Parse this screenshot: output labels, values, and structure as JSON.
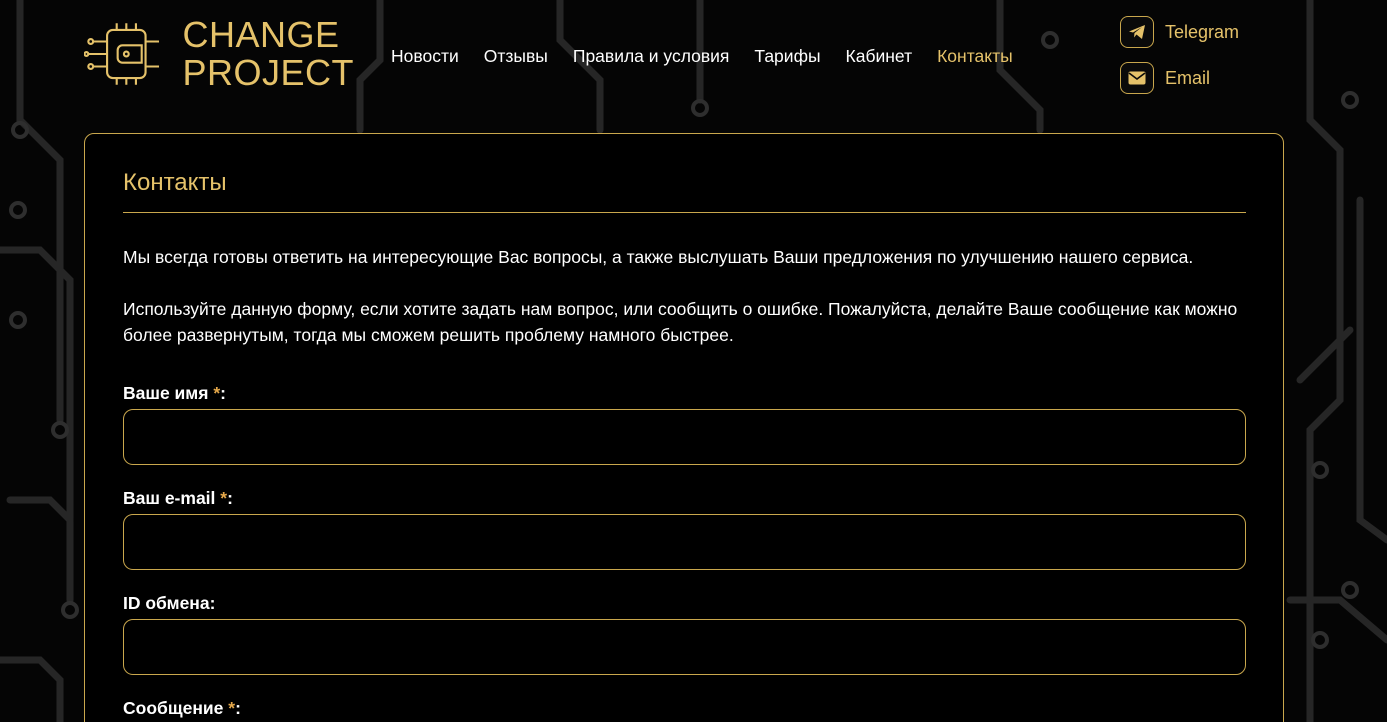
{
  "logo": {
    "line1": "CHANGE",
    "line2": "PROJECT"
  },
  "nav": {
    "items": [
      {
        "label": "Новости"
      },
      {
        "label": "Отзывы"
      },
      {
        "label": "Правила и условия"
      },
      {
        "label": "Тарифы"
      },
      {
        "label": "Кабинет"
      },
      {
        "label": "Контакты",
        "active": true
      }
    ]
  },
  "header_contacts": {
    "telegram": {
      "label": "Telegram",
      "icon": "telegram-icon"
    },
    "email": {
      "label": "Email",
      "icon": "envelope-icon"
    }
  },
  "page": {
    "title": "Контакты",
    "intro1": "Мы всегда готовы ответить на интересующие Вас вопросы, а также выслушать Ваши предложения по улучшению нашего сервиса.",
    "intro2": "Используйте данную форму, если хотите задать нам вопрос, или сообщить о ошибке. Пожалуйста, делайте Ваше сообщение как можно более развернутым, тогда мы сможем решить проблему намного быстрее."
  },
  "form": {
    "name_label": "Ваше имя ",
    "email_label": "Ваш e-mail ",
    "exchange_label": "ID обмена:",
    "message_label": "Сообщение ",
    "required_mark": "*",
    "colon": ":",
    "name_value": "",
    "email_value": "",
    "exchange_value": ""
  },
  "colors": {
    "accent": "#e5c26a",
    "border": "#c9a74d",
    "background": "#000000"
  }
}
